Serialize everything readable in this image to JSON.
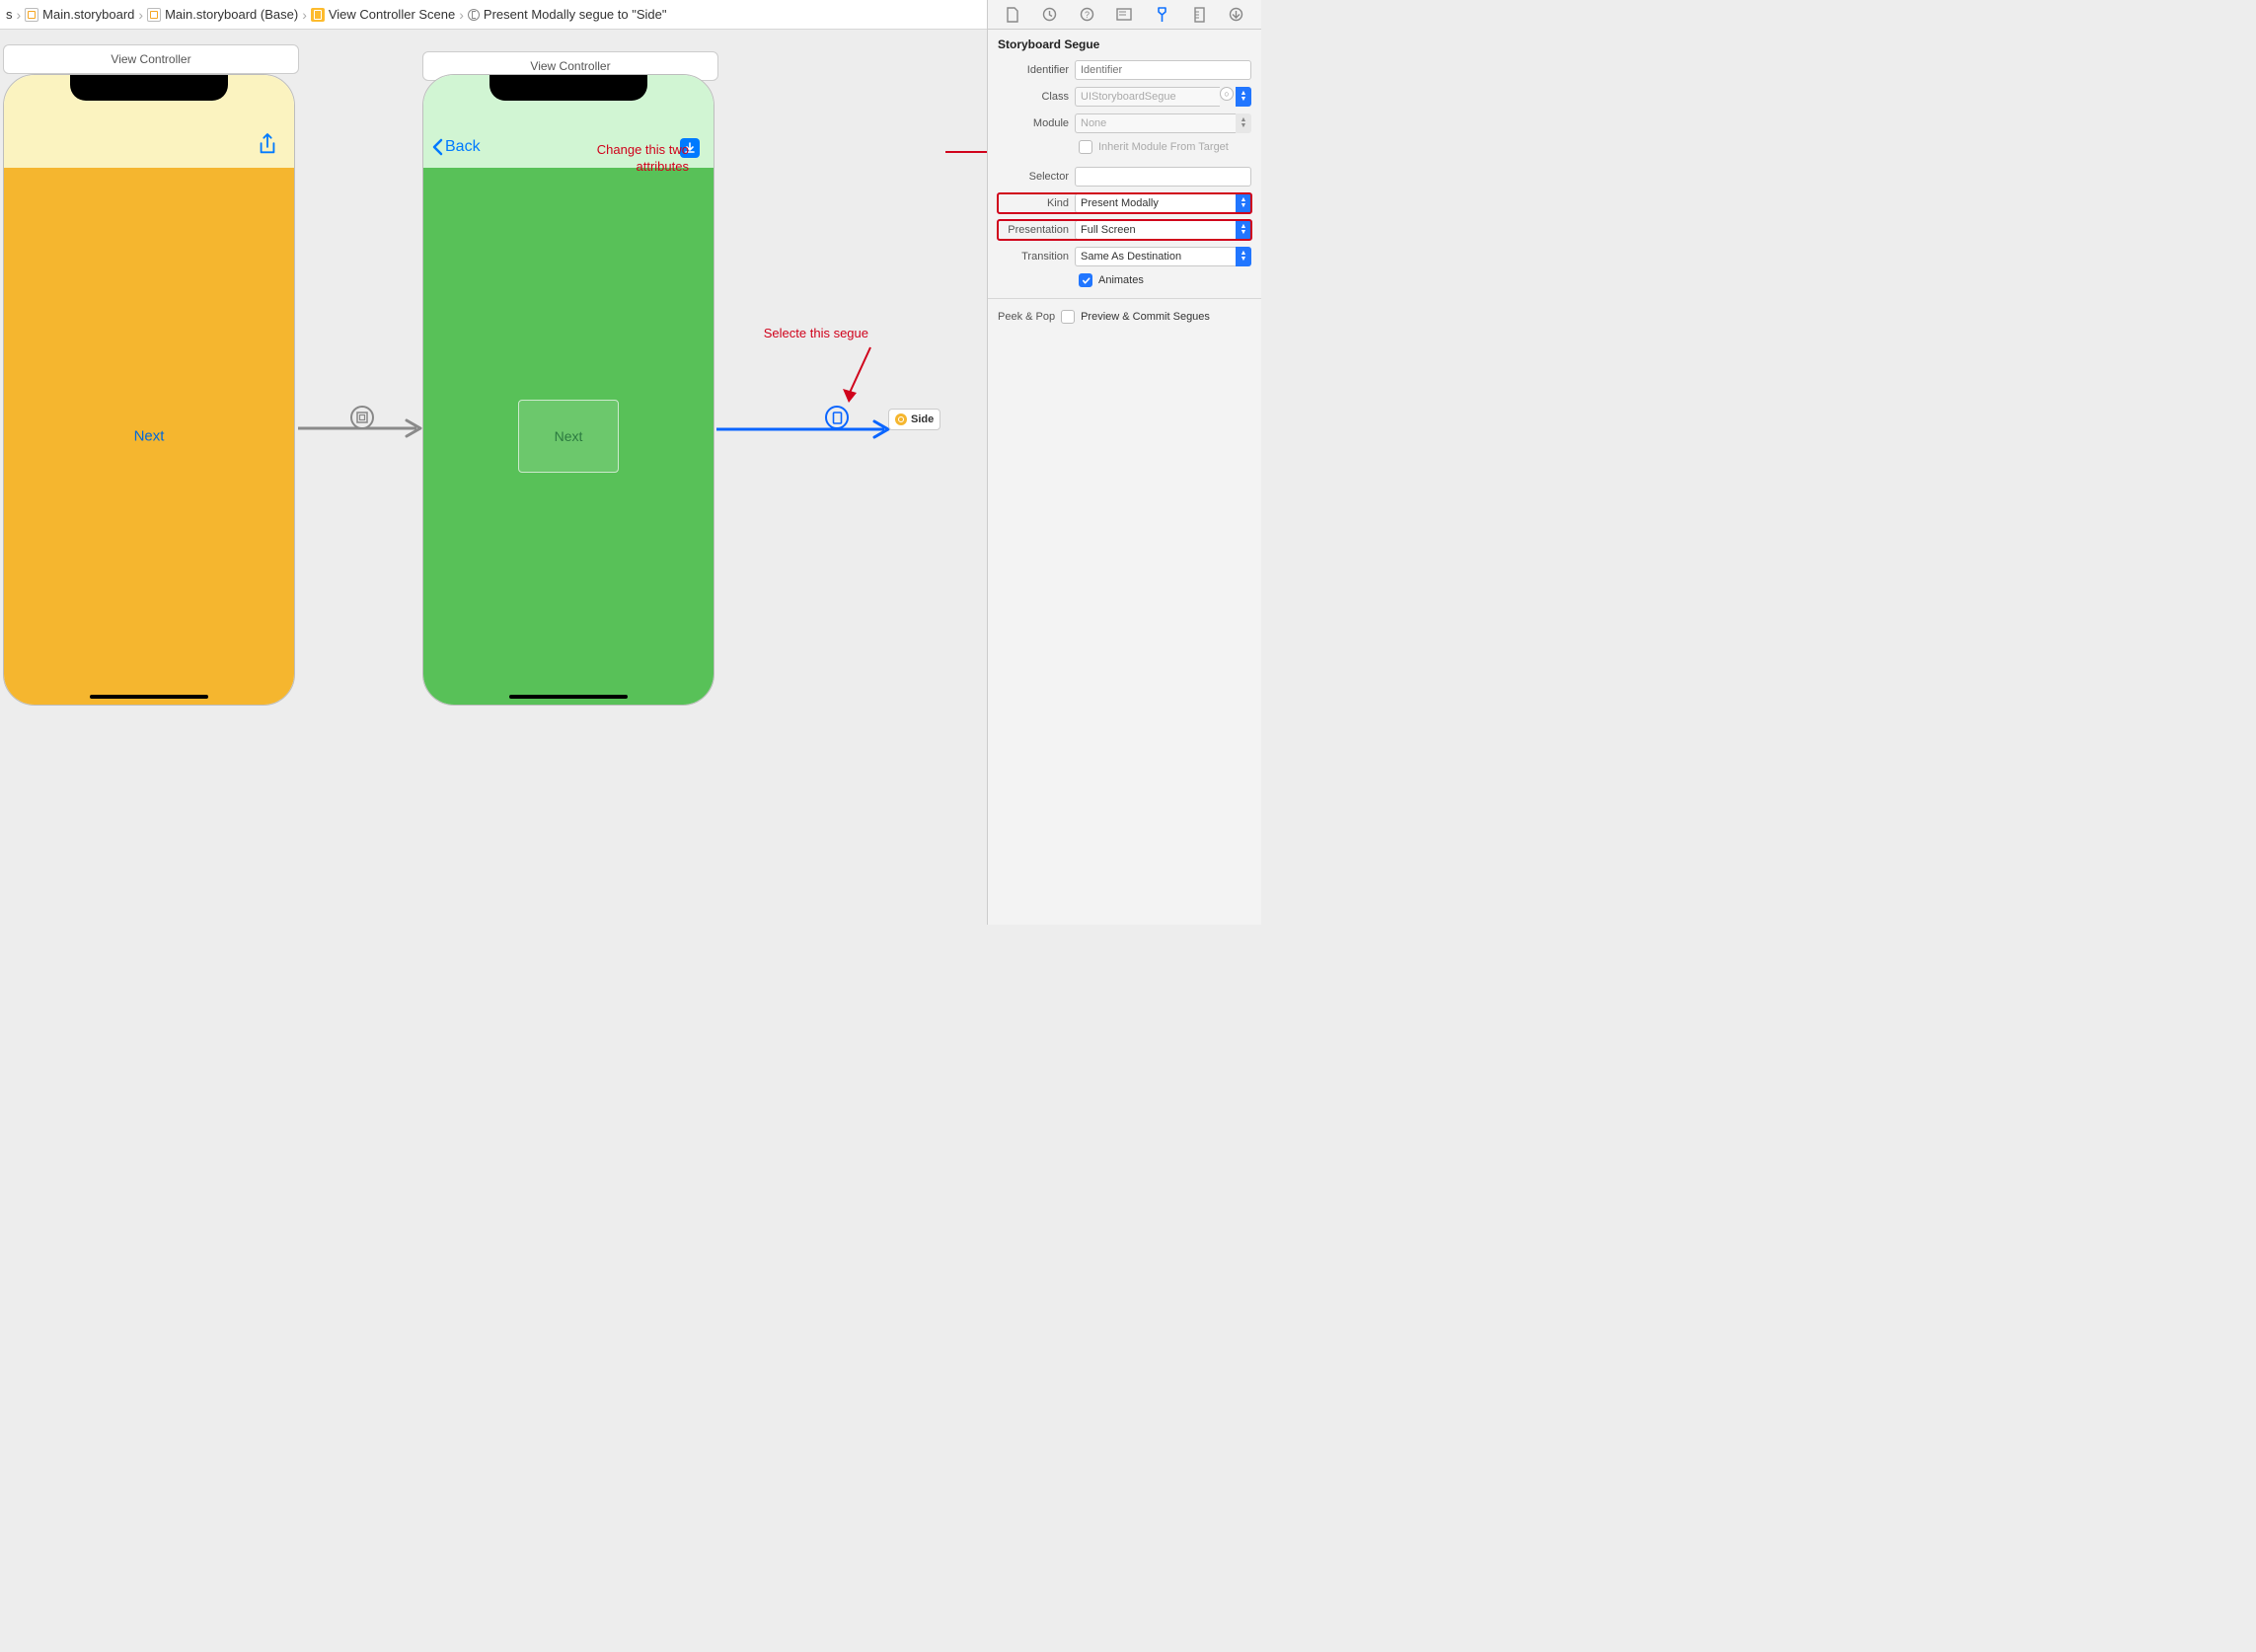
{
  "breadcrumbs": {
    "item0_suffix": "s",
    "item1": "Main.storyboard",
    "item2": "Main.storyboard (Base)",
    "item3": "View Controller Scene",
    "item4": "Present Modally segue to \"Side\""
  },
  "canvas": {
    "vc1_title": "View Controller",
    "vc2_title": "View Controller",
    "phone1_next": "Next",
    "phone2_back": "Back",
    "phone2_next": "Next",
    "side_label": "Side"
  },
  "annotations": {
    "change_line1": "Change this two",
    "change_line2": "attributes",
    "select_segue": "Selecte this segue"
  },
  "inspector": {
    "section": "Storyboard Segue",
    "identifier_label": "Identifier",
    "identifier_placeholder": "Identifier",
    "class_label": "Class",
    "class_value": "UIStoryboardSegue",
    "module_label": "Module",
    "module_value": "None",
    "inherit_label": "Inherit Module From Target",
    "selector_label": "Selector",
    "selector_value": "",
    "kind_label": "Kind",
    "kind_value": "Present Modally",
    "presentation_label": "Presentation",
    "presentation_value": "Full Screen",
    "transition_label": "Transition",
    "transition_value": "Same As Destination",
    "animates_label": "Animates",
    "peek_label": "Peek & Pop",
    "peek_value": "Preview & Commit Segues"
  }
}
